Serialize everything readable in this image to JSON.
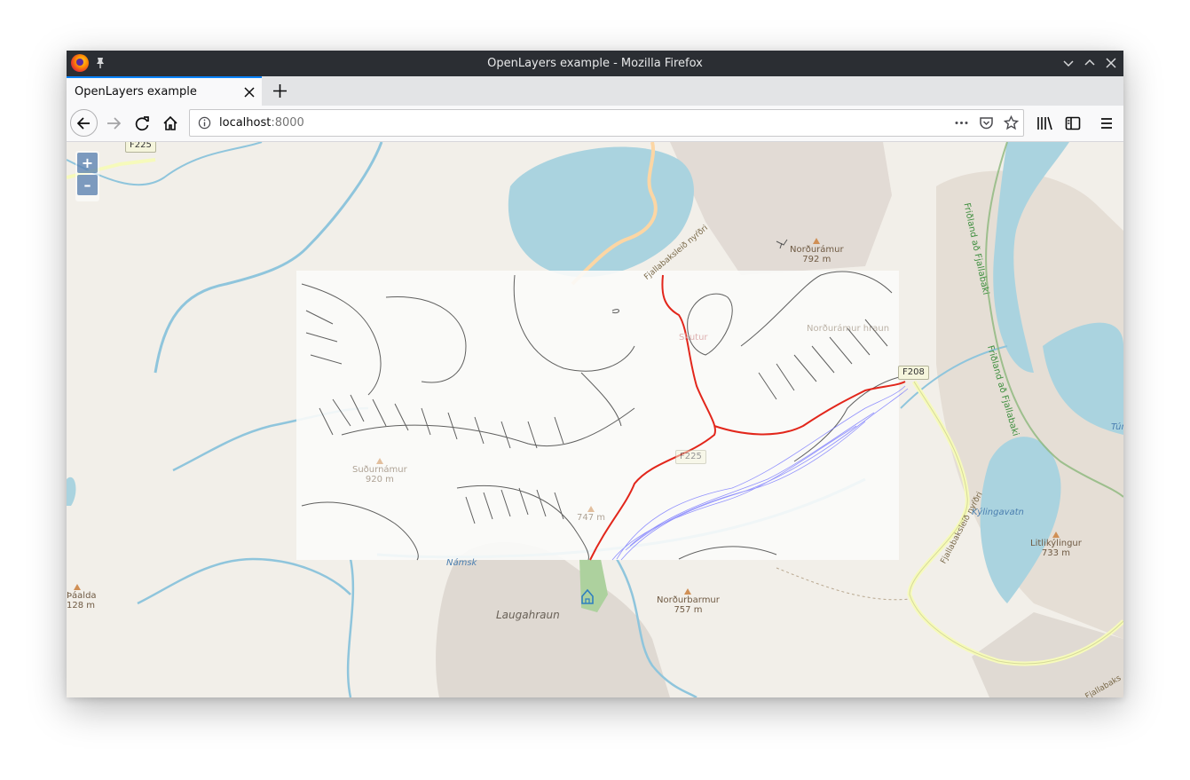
{
  "window": {
    "title": "OpenLayers example - Mozilla Firefox"
  },
  "tab": {
    "title": "OpenLayers example"
  },
  "urlbar": {
    "host": "localhost",
    "port": ":8000"
  },
  "map": {
    "zoom_in": "+",
    "zoom_out": "–",
    "road_shields": [
      "F225",
      "F208",
      "F225"
    ],
    "peaks": [
      {
        "name": "Norðurámur",
        "elevation": "792 m"
      },
      {
        "name": "Suðurnámur",
        "elevation": "920 m"
      },
      {
        "name": "Litlikýlingur",
        "elevation": "733 m"
      },
      {
        "name": "Norðurbarmur",
        "elevation": "757 m"
      },
      {
        "name": "Þáalda",
        "elevation": "128 m"
      },
      {
        "name": "",
        "elevation": "747 m"
      }
    ],
    "areas": {
      "laugahraun": "Laugahraun",
      "kylingavatn": "Kýlingavatn",
      "namskv": "Námsk",
      "tun": "Tún"
    },
    "road_labels": {
      "fjallabak1": "Fjallabaksleið nyŕðri",
      "fjallabak2": "Fjallabaksleíð nyŕðri",
      "fjallabak3": "Fjallabaks"
    },
    "reserve_labels": {
      "r1": "Friðland að Fjallabaki",
      "r2": "Friðland að Fjallabaki"
    },
    "overlay_labels": {
      "sub_peak": "Skutur",
      "faded_area": "Norðurámur hraun"
    },
    "colors": {
      "land": "#f2efe9",
      "water": "#aad3df",
      "river": "#8fc5dc",
      "rock": "#ddd6cf",
      "forest": "#add19e",
      "road_yellow": "#f6fabb",
      "road_orange": "#fcd6a4",
      "reserve": "#8bb77a",
      "overlay": "#fbfbfa",
      "track_red": "#e2261b",
      "track_blue": "#6666ff"
    }
  }
}
